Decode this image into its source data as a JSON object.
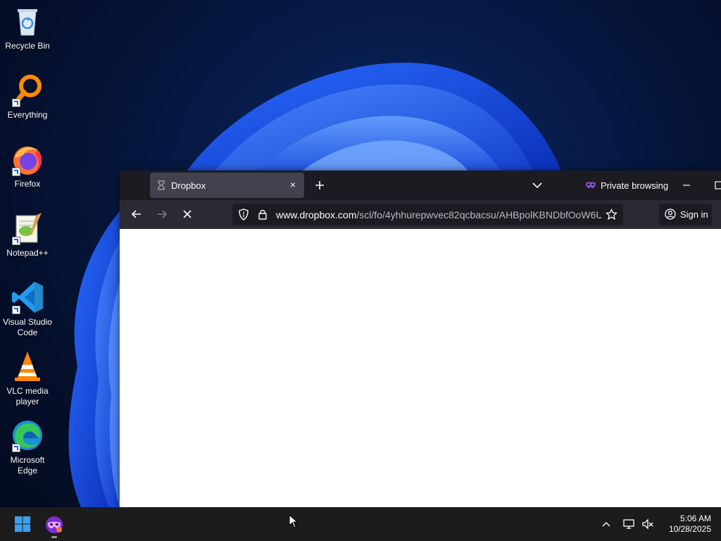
{
  "desktop": {
    "icons": [
      {
        "label": "Recycle Bin",
        "icon": "recycle-bin-icon"
      },
      {
        "label": "Everything",
        "icon": "everything-search-icon"
      },
      {
        "label": "Firefox",
        "icon": "firefox-icon"
      },
      {
        "label": "Notepad++",
        "icon": "notepad-plus-plus-icon"
      },
      {
        "label": "Visual Studio Code",
        "icon": "vscode-icon"
      },
      {
        "label": "VLC media player",
        "icon": "vlc-icon"
      },
      {
        "label": "Microsoft Edge",
        "icon": "edge-icon"
      }
    ]
  },
  "browser": {
    "tab": {
      "title": "Dropbox",
      "close": "×"
    },
    "private_label": "Private browsing",
    "url": {
      "domain": "www.dropbox.com",
      "path": "/scl/fo/4yhhurepwvec82qcbacsu/AHBpolKBNDbfOoW6U"
    },
    "signin_label": "Sign in"
  },
  "taskbar": {
    "time": "5:06 AM",
    "date": "10/28/2025"
  },
  "colors": {
    "browser_bg": "#1c1b22",
    "toolbar_bg": "#2b2a33",
    "tab_active": "#42414d",
    "private_purple": "#8f4cd6",
    "taskbar_bg": "#1c1c1c"
  }
}
